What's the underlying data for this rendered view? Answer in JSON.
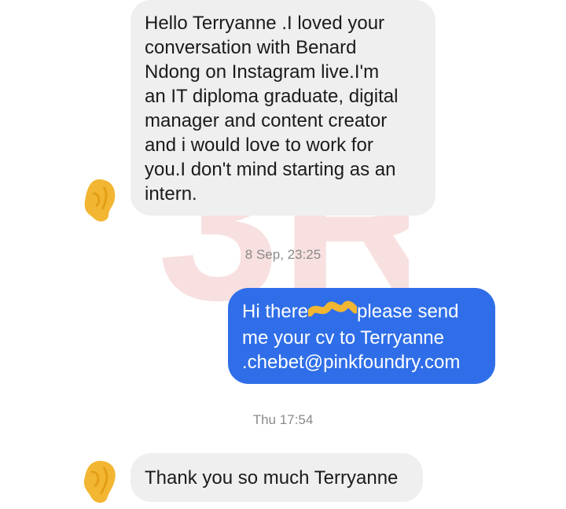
{
  "conversation": {
    "messages": [
      {
        "direction": "incoming",
        "lines": [
          "Hello Terryanne .I loved your",
          "conversation with Benard",
          "Ndong on Instagram live.I'm",
          "an IT diploma graduate,  digital",
          "manager and content creator",
          "and i would love to work for",
          "you.I don't mind starting as an",
          "intern."
        ]
      },
      {
        "direction": "outgoing",
        "line1_before": "Hi there",
        "line1_after": "please send",
        "line2": "me your cv to Terryanne",
        "line3": ".chebet@pinkfoundry.com"
      },
      {
        "direction": "incoming",
        "text": "Thank you so much Terryanne"
      }
    ],
    "timestamps": [
      "8 Sep, 23:25",
      "Thu 17:54"
    ]
  },
  "colors": {
    "incoming_bubble": "#efefef",
    "outgoing_bubble": "#2f6ee8",
    "redaction": "#f2b632",
    "timestamp_text": "#8a8a8a",
    "watermark": "#d64545"
  }
}
